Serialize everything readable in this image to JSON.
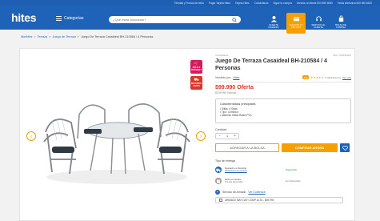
{
  "topbar": {
    "items": [
      "Tiendas y Puntos de retiro",
      "Pagar Tarjeta Hites",
      "Tarjeta Hites",
      "Contáctanos",
      "Sigue tu compra",
      "Servicio al cliente 600 550 8000",
      "Venta telefónica 600 550 8300"
    ]
  },
  "header": {
    "logo": "hites",
    "categories_label": "Categorías",
    "search_placeholder": "¿Qué estás buscando?",
    "tiles": [
      {
        "label": "CLIENTE INGRESO",
        "icon": "user-icon"
      },
      {
        "label": "SOLICITA TU TARJETA",
        "icon": "card-icon"
      },
      {
        "label": "SERVICIO AL CLIENTE",
        "icon": "support-icon"
      },
      {
        "label": "BOLSA DE COMPRA",
        "icon": "bag-icon"
      }
    ]
  },
  "breadcrumb": {
    "items": [
      "Muebles",
      "Terraza",
      "Juego de Terraza"
    ],
    "current": "Juego De Terraza Casaideal BH-210584 / 4 Personas"
  },
  "product": {
    "brand": "CASAIDEAL",
    "sku": "SKU: 051156001",
    "title": "Juego De Terraza Casaideal BH-210584 / 4 Personas",
    "sold_by_label": "Vendido por:",
    "seller": "Hites",
    "rating_value": "5.0",
    "stars": "★★★★★",
    "rating_count": "0 Valoraciones",
    "rating_link": "Ver más",
    "price": "$99.990 Oferta",
    "price_normal": "$199.990 Normal",
    "badges": [
      {
        "name": "solo-x-internet-badge",
        "text": "SOLO X INTERNET",
        "color": "#d8185b"
      },
      {
        "name": "mejores-antes-badge",
        "text": "MEJORES ANTES",
        "color": "#e0342a"
      }
    ]
  },
  "features": {
    "title": "Características principales",
    "items": [
      "• Sillas: 4 Sillas",
      "• Tipo: Comedor",
      "• Material: Metal-Ratán PVC"
    ]
  },
  "quantity": {
    "label": "Cantidad",
    "minus": "−",
    "value": "1",
    "plus": "+"
  },
  "actions": {
    "add_to_bag": "AGREGAR A LA BOLSA",
    "buy_now": "COMPRAR AHORA"
  },
  "delivery": {
    "title": "Tipo de entrega",
    "options": [
      {
        "main": "Despacho a Domicilio",
        "sub": "Selecciona una comuna",
        "status": "Disponible",
        "status_color": "#1f9a3a"
      },
      {
        "main": "Retiro en tienda",
        "sub": "Tiendas disponibles",
        "status": "No Disponible",
        "status_color": "#777777"
      }
    ]
  },
  "assembly": {
    "label": "Servicio de Armado",
    "link": "Ver Cobertura",
    "option": "ARMADO MAY DAY COMP ALTA - $39.990"
  }
}
